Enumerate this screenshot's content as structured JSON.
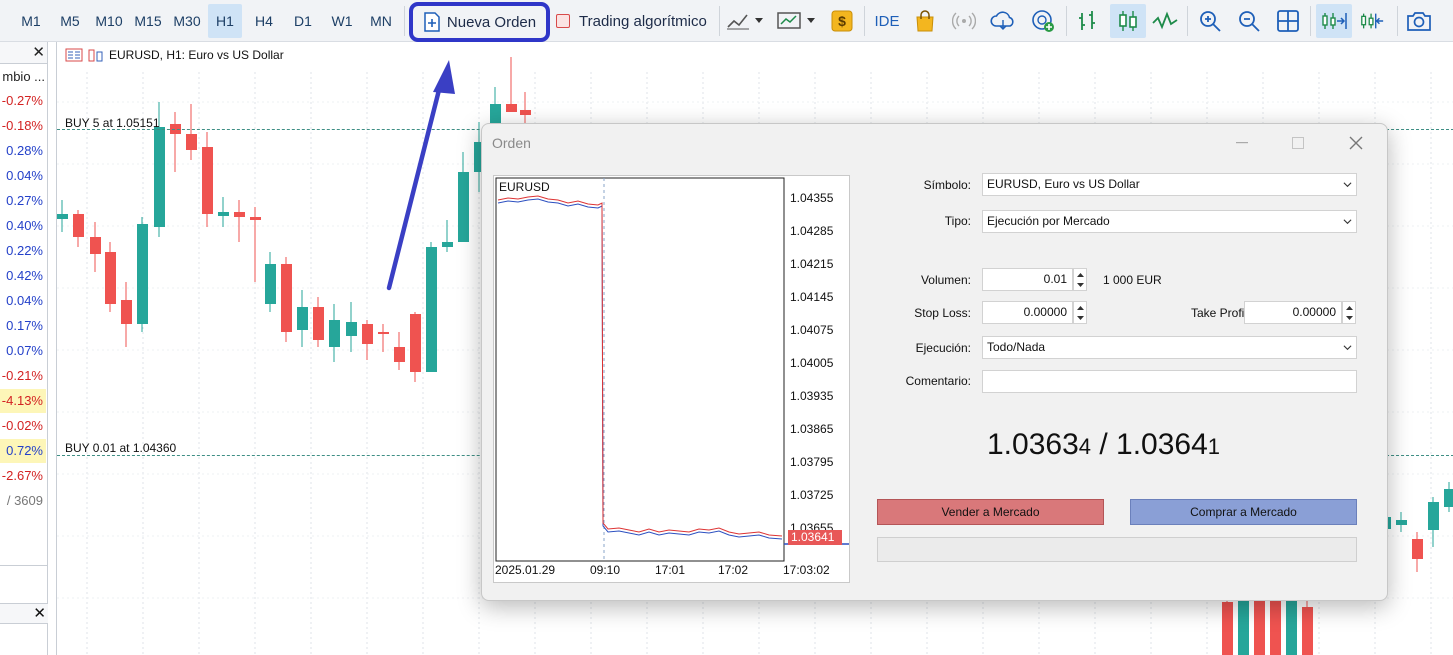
{
  "toolbar": {
    "timeframes": [
      "M1",
      "M5",
      "M10",
      "M15",
      "M30",
      "H1",
      "H4",
      "D1",
      "W1",
      "MN"
    ],
    "active_timeframe": "H1",
    "new_order_label": "Nueva Orden",
    "algo_trading_label": "Trading algorítmico",
    "ide_label": "IDE",
    "icons": [
      "new-order-icon",
      "algo-trading-icon",
      "line-chart-icon",
      "chart-template-icon",
      "dollar-icon",
      "ide-icon",
      "market-bag-icon",
      "signals-icon",
      "cloud-icon",
      "vps-icon",
      "bar-chart-icon",
      "candlestick-chart-icon",
      "line-chart-type-icon",
      "zoom-in-icon",
      "zoom-out-icon",
      "grid-tile-icon",
      "autoscroll-icon",
      "chart-shift-icon",
      "screenshot-icon"
    ]
  },
  "market_watch": {
    "column_header": "mbio ...",
    "changes": [
      {
        "value": "-0.27%",
        "color": "#d32222",
        "highlight": false
      },
      {
        "value": "-0.18%",
        "color": "#d32222",
        "highlight": false
      },
      {
        "value": "0.28%",
        "color": "#2340c9",
        "highlight": false
      },
      {
        "value": "0.04%",
        "color": "#2340c9",
        "highlight": false
      },
      {
        "value": "0.27%",
        "color": "#2340c9",
        "highlight": false
      },
      {
        "value": "0.40%",
        "color": "#2340c9",
        "highlight": false
      },
      {
        "value": "0.22%",
        "color": "#2340c9",
        "highlight": false
      },
      {
        "value": "0.42%",
        "color": "#2340c9",
        "highlight": false
      },
      {
        "value": "0.04%",
        "color": "#2340c9",
        "highlight": false
      },
      {
        "value": "0.17%",
        "color": "#2340c9",
        "highlight": false
      },
      {
        "value": "0.07%",
        "color": "#2340c9",
        "highlight": false
      },
      {
        "value": "-0.21%",
        "color": "#d32222",
        "highlight": false
      },
      {
        "value": "-4.13%",
        "color": "#d32222",
        "highlight": true
      },
      {
        "value": "-0.02%",
        "color": "#d32222",
        "highlight": false
      },
      {
        "value": "0.72%",
        "color": "#2340c9",
        "highlight": true
      },
      {
        "value": "-2.67%",
        "color": "#d32222",
        "highlight": false
      },
      {
        "value": "/ 3609",
        "color": "#777777",
        "highlight": false
      }
    ]
  },
  "chart": {
    "title": "EURUSD, H1:  Euro vs US Dollar",
    "levels": [
      {
        "label": "BUY 5 at 1.05151"
      },
      {
        "label": "BUY 0.01 at 1.04360"
      }
    ],
    "colors": {
      "bull": "#26a69a",
      "bear": "#ef5350",
      "annotation": "#3a3fc4"
    }
  },
  "dialog": {
    "title": "Orden",
    "mini_chart": {
      "symbol": "EURUSD",
      "price_labels": [
        "1.04355",
        "1.04285",
        "1.04215",
        "1.04145",
        "1.04075",
        "1.04005",
        "1.03935",
        "1.03865",
        "1.03795",
        "1.03725",
        "1.03655"
      ],
      "current_price": "1.03641",
      "time_labels": [
        "2025.01.29",
        "09:10",
        "17:01",
        "17:02",
        "17:03:02"
      ]
    },
    "symbol_label": "Símbolo:",
    "symbol_value": "EURUSD, Euro vs US Dollar",
    "type_label": "Tipo:",
    "type_value": "Ejecución por Mercado",
    "volume_label": "Volumen:",
    "volume_value": "0.01",
    "volume_unit": "1 000 EUR",
    "stoploss_label": "Stop Loss:",
    "stoploss_value": "0.00000",
    "takeprofit_label": "Take Profit:",
    "takeprofit_value": "0.00000",
    "execution_label": "Ejecución:",
    "execution_value": "Todo/Nada",
    "comment_label": "Comentario:",
    "comment_value": "",
    "bid_main": "1.0363",
    "bid_small": "4",
    "separator": " / ",
    "ask_main": "1.0364",
    "ask_small": "1",
    "sell_label": "Vender a Mercado",
    "buy_label": "Comprar a Mercado"
  }
}
